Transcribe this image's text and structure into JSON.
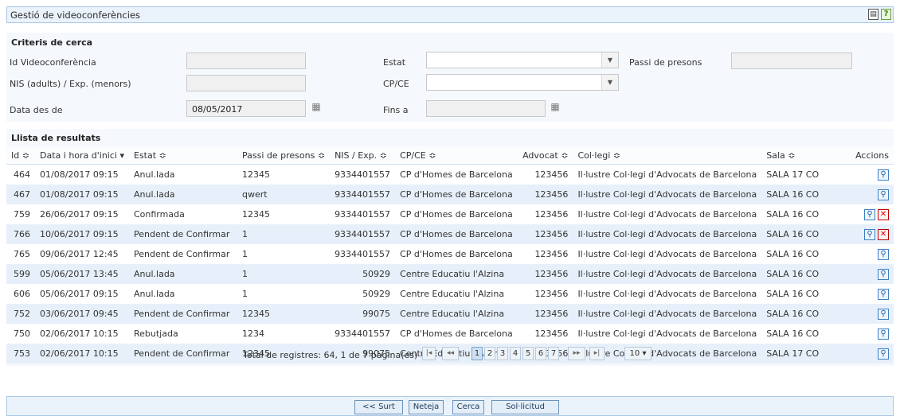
{
  "header": {
    "title": "Gestió de videoconferències",
    "print_icon": "print-icon",
    "help_icon": "help-icon"
  },
  "criteria": {
    "title": "Criteris de cerca",
    "id_label": "Id Videoconferència",
    "estat_label": "Estat",
    "passi_label": "Passi de presons",
    "nis_label": "NIS (adults) / Exp. (menors)",
    "cpce_label": "CP/CE",
    "date_from_label": "Data des de",
    "date_from_value": "08/05/2017",
    "date_to_label": "Fins a",
    "id_value": "",
    "passi_value": "",
    "nis_value": "",
    "date_to_value": ""
  },
  "results": {
    "title": "Llista de resultats",
    "columns": [
      "Id ≎",
      "Data i hora d'inici ▾",
      "Estat ≎",
      "Passi de presons ≎",
      "NIS / Exp. ≎",
      "CP/CE ≎",
      "Advocat ≎",
      "Col·legi ≎",
      "Sala ≎",
      "Accions"
    ],
    "rows": [
      [
        "464",
        "01/08/2017 09:15",
        "Anul.lada",
        "12345",
        "9334401557",
        "CP d'Homes de Barcelona",
        "123456",
        "Il·lustre Col·legi d'Advocats de Barcelona",
        "SALA 17 CO"
      ],
      [
        "467",
        "01/08/2017 09:15",
        "Anul.lada",
        "qwert",
        "9334401557",
        "CP d'Homes de Barcelona",
        "123456",
        "Il·lustre Col·legi d'Advocats de Barcelona",
        "SALA 16 CO"
      ],
      [
        "759",
        "26/06/2017 09:15",
        "Confirmada",
        "12345",
        "9334401557",
        "CP d'Homes de Barcelona",
        "123456",
        "Il·lustre Col·legi d'Advocats de Barcelona",
        "SALA 16 CO"
      ],
      [
        "766",
        "10/06/2017 09:15",
        "Pendent de Confirmar",
        "1",
        "9334401557",
        "CP d'Homes de Barcelona",
        "123456",
        "Il·lustre Col·legi d'Advocats de Barcelona",
        "SALA 16 CO"
      ],
      [
        "765",
        "09/06/2017 12:45",
        "Pendent de Confirmar",
        "1",
        "9334401557",
        "CP d'Homes de Barcelona",
        "123456",
        "Il·lustre Col·legi d'Advocats de Barcelona",
        "SALA 16 CO"
      ],
      [
        "599",
        "05/06/2017 13:45",
        "Anul.lada",
        "1",
        "50929",
        "Centre Educatiu l'Alzina",
        "123456",
        "Il·lustre Col·legi d'Advocats de Barcelona",
        "SALA 16 CO"
      ],
      [
        "606",
        "05/06/2017 09:15",
        "Anul.lada",
        "1",
        "50929",
        "Centre Educatiu l'Alzina",
        "123456",
        "Il·lustre Col·legi d'Advocats de Barcelona",
        "SALA 16 CO"
      ],
      [
        "752",
        "03/06/2017 09:45",
        "Pendent de Confirmar",
        "12345",
        "99075",
        "Centre Educatiu l'Alzina",
        "123456",
        "Il·lustre Col·legi d'Advocats de Barcelona",
        "SALA 16 CO"
      ],
      [
        "750",
        "02/06/2017 10:15",
        "Rebutjada",
        "1234",
        "9334401557",
        "CP d'Homes de Barcelona",
        "123456",
        "Il·lustre Col·legi d'Advocats de Barcelona",
        "SALA 16 CO"
      ],
      [
        "753",
        "02/06/2017 10:15",
        "Pendent de Confirmar",
        "12345",
        "99075",
        "Centre Educatiu l'Alzina",
        "123456",
        "Il·lustre Col·legi d'Advocats de Barcelona",
        "SALA 17 CO"
      ]
    ],
    "row_actions": [
      [
        "view"
      ],
      [
        "view"
      ],
      [
        "view",
        "delete"
      ],
      [
        "view",
        "delete"
      ],
      [
        "view"
      ],
      [
        "view"
      ],
      [
        "view"
      ],
      [
        "view"
      ],
      [
        "view"
      ],
      [
        "view"
      ]
    ]
  },
  "pager": {
    "total_text": "Total de registres: 64, 1 de 7 pàgina(es)",
    "first": "|◂",
    "prev": "◂◂",
    "next": "▸▸",
    "last": "▸|",
    "pages": [
      "1",
      "2",
      "3",
      "4",
      "5",
      "6",
      "7"
    ],
    "current_page": "1",
    "page_size": "10"
  },
  "footer": {
    "back": "<< Surt",
    "clear": "Neteja",
    "search": "Cerca",
    "request": "Sol·licitud"
  }
}
